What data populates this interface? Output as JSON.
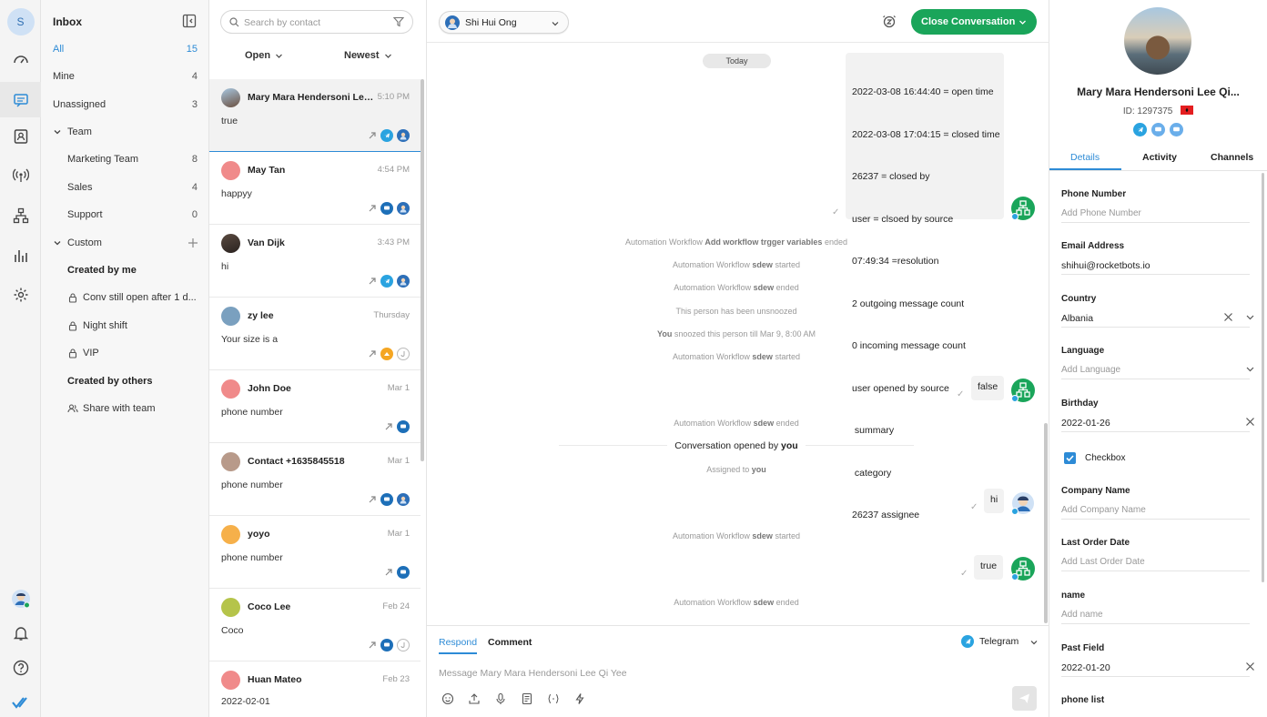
{
  "rail": {
    "user_initial": "S"
  },
  "sidebar": {
    "title": "Inbox",
    "items": [
      {
        "label": "All",
        "count": "15"
      },
      {
        "label": "Mine",
        "count": "4"
      },
      {
        "label": "Unassigned",
        "count": "3"
      }
    ],
    "team_label": "Team",
    "teams": [
      {
        "label": "Marketing Team",
        "count": "8"
      },
      {
        "label": "Sales",
        "count": "4"
      },
      {
        "label": "Support",
        "count": "0"
      }
    ],
    "custom_label": "Custom",
    "created_by_me": "Created by me",
    "custom_views": [
      "Conv still open after 1 d...",
      "Night shift",
      "VIP"
    ],
    "created_by_others": "Created by others",
    "share_with_team": "Share with team"
  },
  "list": {
    "search_placeholder": "Search by contact",
    "filter_status": "Open",
    "filter_sort": "Newest",
    "conversations": [
      {
        "name": "Mary Mara Hendersoni Lee ...",
        "time": "5:10 PM",
        "preview": "true"
      },
      {
        "name": "May Tan",
        "time": "4:54 PM",
        "preview": "happyy"
      },
      {
        "name": "Van Dijk",
        "time": "3:43 PM",
        "preview": "hi"
      },
      {
        "name": "zy lee",
        "time": "Thursday",
        "preview": "Your size is a"
      },
      {
        "name": "John Doe",
        "time": "Mar 1",
        "preview": "phone number"
      },
      {
        "name": "Contact +1635845518",
        "time": "Mar 1",
        "preview": "phone number"
      },
      {
        "name": "yoyo",
        "time": "Mar 1",
        "preview": "phone number"
      },
      {
        "name": "Coco Lee",
        "time": "Feb 24",
        "preview": "Coco"
      },
      {
        "name": "Huan Mateo",
        "time": "Feb 23",
        "preview": "2022-02-01"
      }
    ]
  },
  "chat": {
    "assignee": "Shi Hui Ong",
    "close_button": "Close Conversation",
    "today": "Today",
    "summary_lines": [
      "2022-03-08 16:44:40 = open time",
      "2022-03-08 17:04:15 = closed time",
      "26237 = closed by",
      "user = clsoed by source",
      "07:49:34 =resolution",
      "2 outgoing message count",
      "0 incoming message count",
      "user opened by source",
      " summary",
      " category",
      "26237 assignee"
    ],
    "system_messages": [
      {
        "pre": "Automation Workflow ",
        "bold": "Add workflow trgger variables",
        "post": " ended"
      },
      {
        "pre": "Automation Workflow ",
        "bold": "sdew",
        "post": " started"
      },
      {
        "pre": "Automation Workflow ",
        "bold": "sdew",
        "post": " ended"
      },
      {
        "pre": "This person has been unsnoozed",
        "bold": "",
        "post": ""
      },
      {
        "pre": "",
        "bold": "You",
        "post": " snoozed this person till Mar 9, 8:00 AM"
      },
      {
        "pre": "Automation Workflow ",
        "bold": "sdew",
        "post": " started"
      },
      {
        "pre": "Automation Workflow ",
        "bold": "sdew",
        "post": " ended"
      },
      {
        "pre": "Assigned to ",
        "bold": "you",
        "post": ""
      },
      {
        "pre": "Automation Workflow ",
        "bold": "sdew",
        "post": " started"
      },
      {
        "pre": "Automation Workflow ",
        "bold": "sdew",
        "post": " ended"
      }
    ],
    "msg_false": "false",
    "msg_hi": "hi",
    "msg_true": "true",
    "opened_pre": "Conversation opened by ",
    "opened_bold": "you",
    "tab_respond": "Respond",
    "tab_comment": "Comment",
    "channel": "Telegram",
    "message_placeholder": "Message Mary Mara Hendersoni Lee Qi Yee"
  },
  "profile": {
    "name": "Mary Mara Hendersoni Lee Qi...",
    "id": "ID: 1297375",
    "tabs": [
      "Details",
      "Activity",
      "Channels"
    ],
    "fields": [
      {
        "label": "Phone Number",
        "value": "Add Phone Number"
      },
      {
        "label": "Email Address",
        "value": "shihui@rocketbots.io"
      },
      {
        "label": "Country",
        "value": "Albania"
      },
      {
        "label": "Language",
        "value": "Add Language"
      },
      {
        "label": "Birthday",
        "value": "2022-01-26"
      },
      {
        "label": "Company Name",
        "value": "Add Company Name"
      },
      {
        "label": "Last Order Date",
        "value": "Add Last Order Date"
      },
      {
        "label": "name",
        "value": "Add name"
      },
      {
        "label": "Past Field",
        "value": "2022-01-20"
      },
      {
        "label": "phone list",
        "value": ""
      }
    ],
    "checkbox_label": "Checkbox"
  },
  "colors": {
    "accent": "#2d8bd6",
    "success": "#1aa55a",
    "telegram": "#2aa3e0",
    "livechat": "#1d6fb8"
  }
}
